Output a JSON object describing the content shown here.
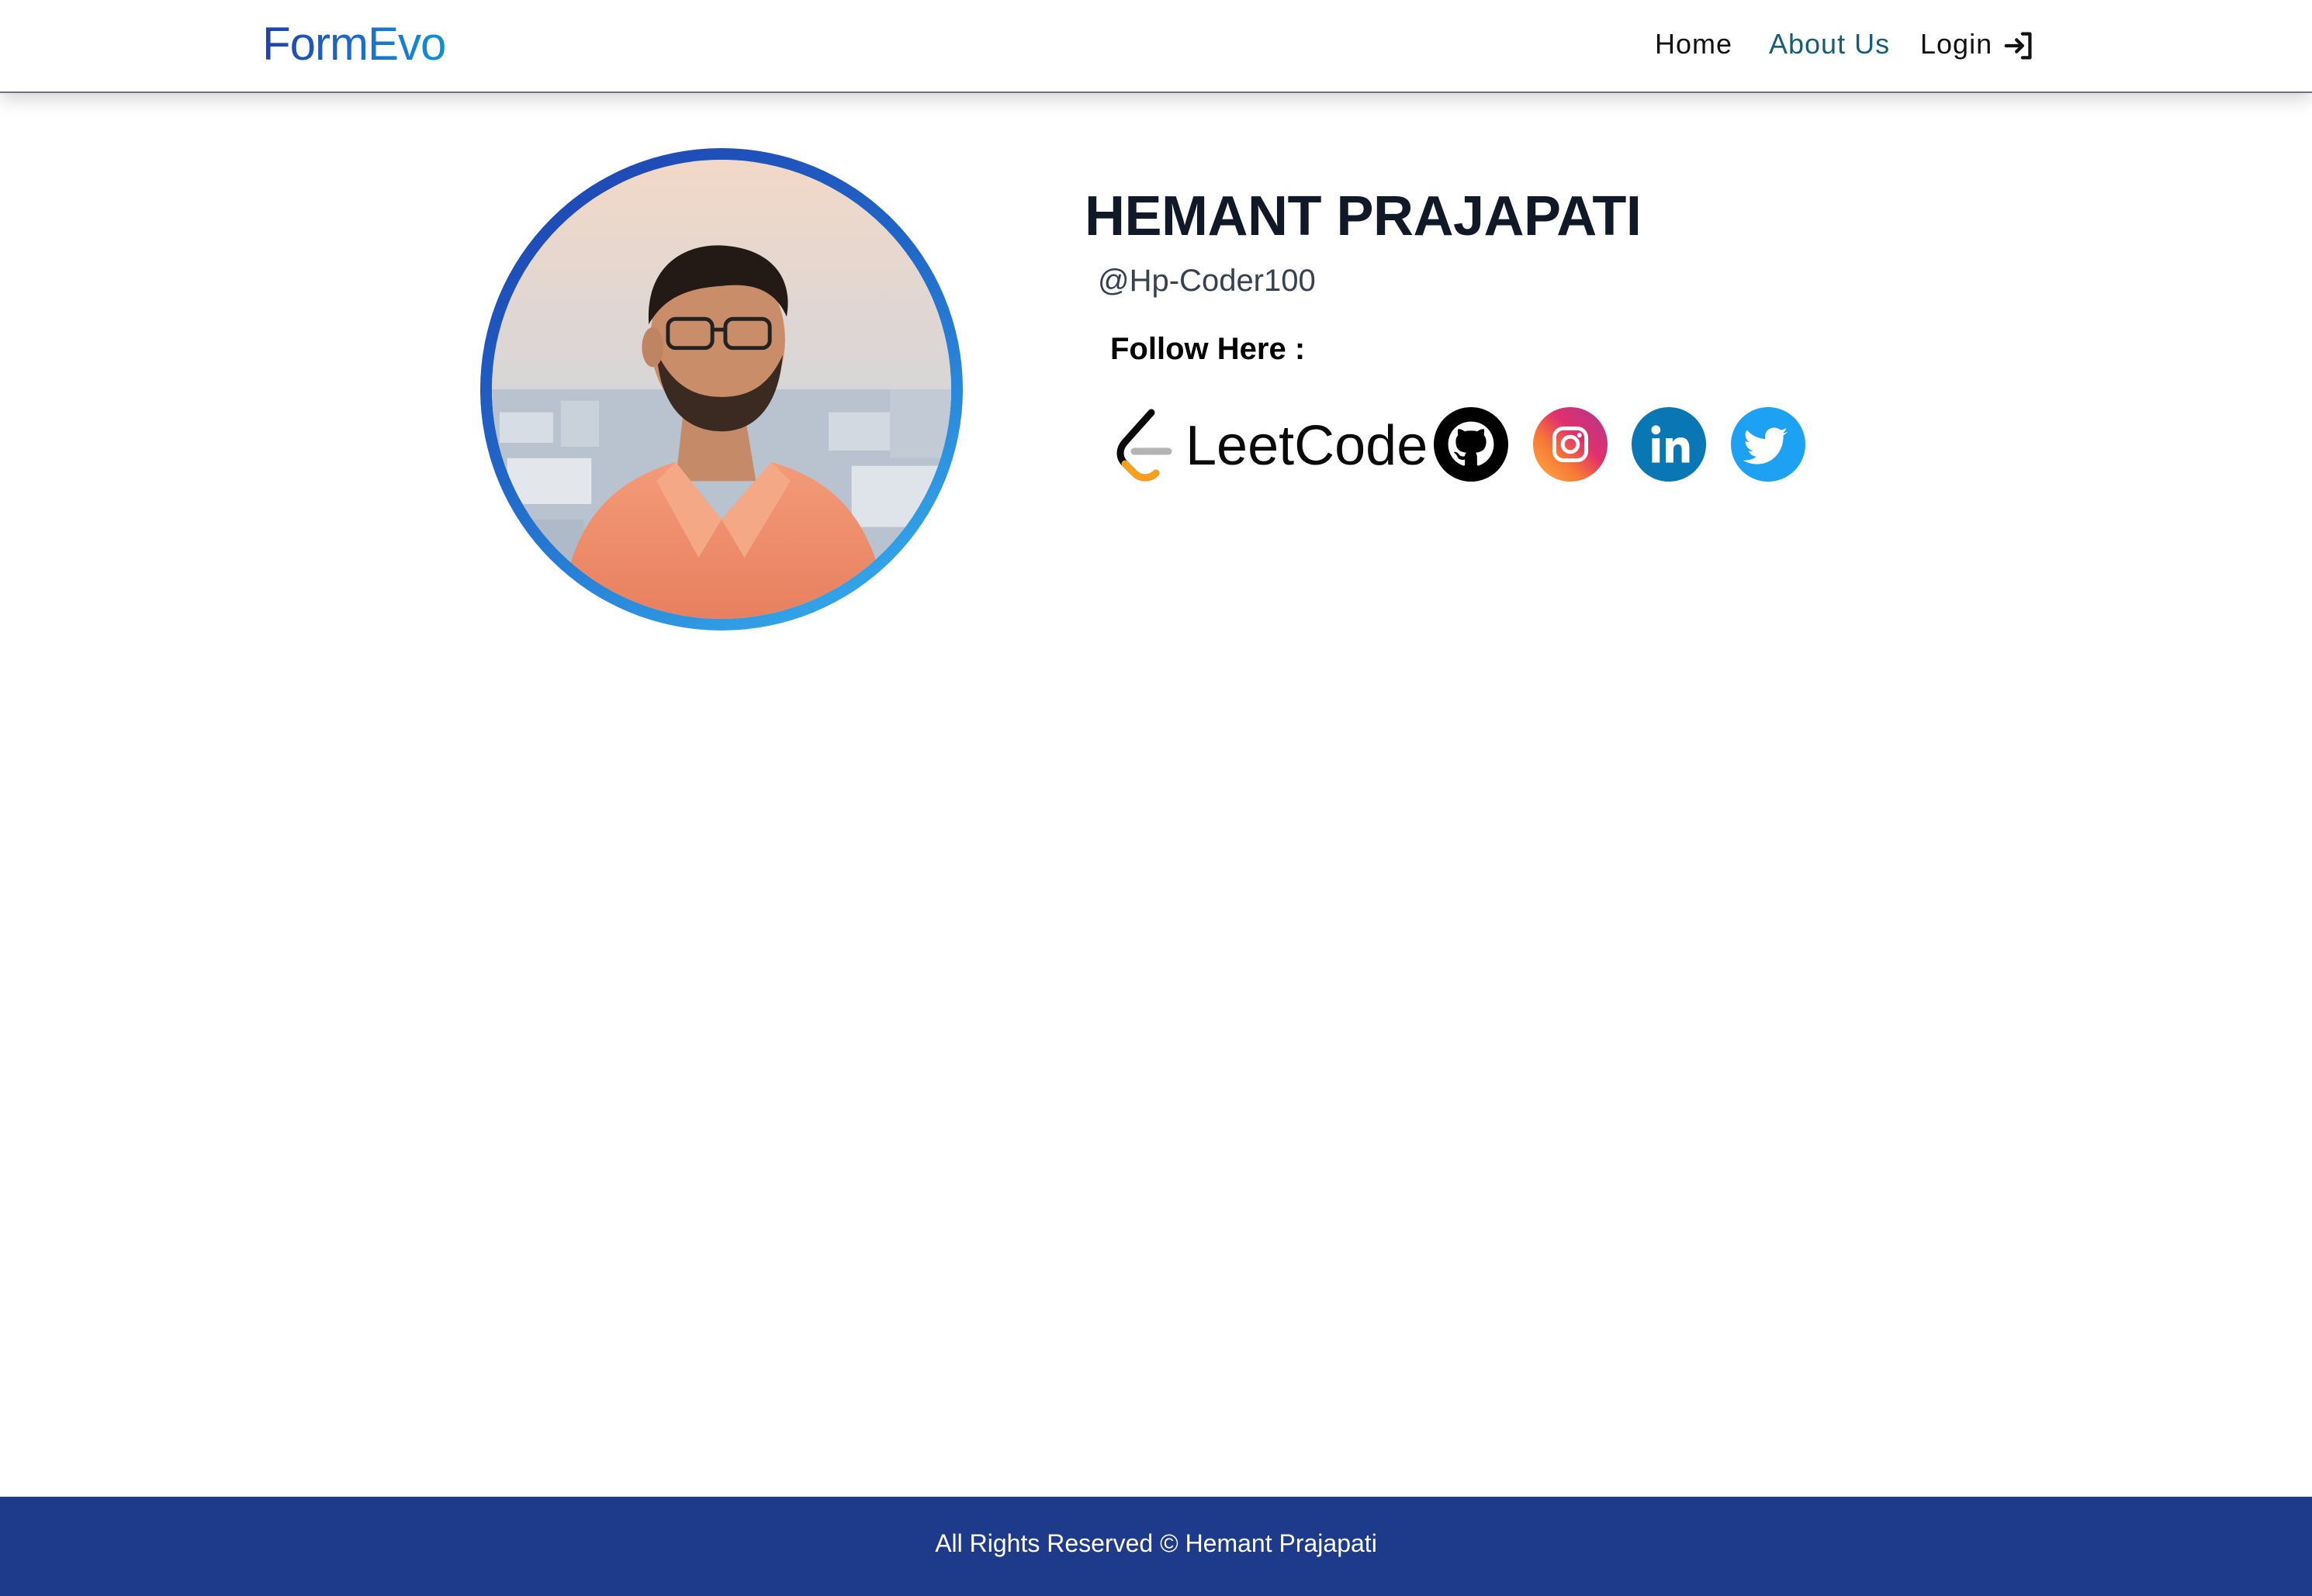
{
  "navbar": {
    "brand": "FormEvo",
    "links": {
      "home": "Home",
      "about": "About Us",
      "login": "Login"
    },
    "login_icon": "login-arrow-icon"
  },
  "profile": {
    "name": "HEMANT PRAJAPATI",
    "handle": "@Hp-Coder100",
    "follow_label": "Follow Here :",
    "socials": [
      {
        "label": "LeetCode",
        "icon": "leetcode-icon",
        "color": "#f89f1b"
      },
      {
        "label": "",
        "icon": "github-icon",
        "color": "#000000"
      },
      {
        "label": "",
        "icon": "instagram-icon",
        "color": "#d62976"
      },
      {
        "label": "",
        "icon": "linkedin-icon",
        "color": "#0a77b5"
      },
      {
        "label": "",
        "icon": "twitter-icon",
        "color": "#1da1f2"
      }
    ]
  },
  "footer": {
    "text": "All Rights Reserved © Hemant Prajapati"
  },
  "colors": {
    "accent": "#1e40af",
    "footer_bg": "#1e3a8a",
    "active_link": "#155e75"
  }
}
